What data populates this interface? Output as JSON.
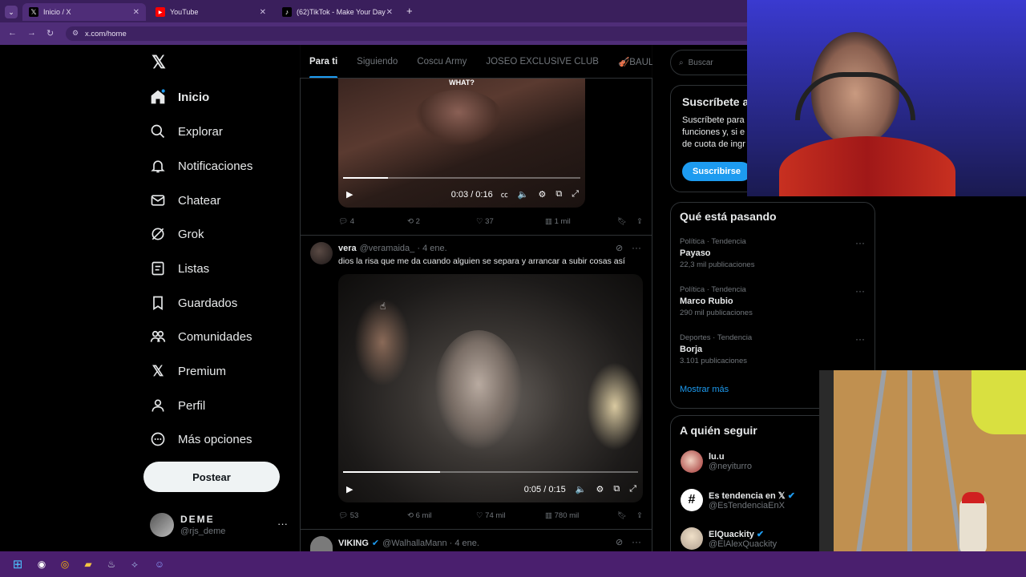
{
  "browser": {
    "tabs": [
      {
        "label": "Inicio / X",
        "icon": "x-logo-icon",
        "active": true
      },
      {
        "label": "YouTube",
        "icon": "youtube-icon",
        "active": false
      },
      {
        "label": "(62)TikTok - Make Your Day",
        "icon": "tiktok-icon",
        "active": false
      }
    ],
    "url": "x.com/home"
  },
  "sidebar": {
    "items": [
      {
        "label": "Inicio",
        "icon": "home-icon"
      },
      {
        "label": "Explorar",
        "icon": "search-icon"
      },
      {
        "label": "Notificaciones",
        "icon": "bell-icon"
      },
      {
        "label": "Chatear",
        "icon": "mail-icon"
      },
      {
        "label": "Grok",
        "icon": "grok-icon"
      },
      {
        "label": "Listas",
        "icon": "list-icon"
      },
      {
        "label": "Guardados",
        "icon": "bookmark-icon"
      },
      {
        "label": "Comunidades",
        "icon": "people-icon"
      },
      {
        "label": "Premium",
        "icon": "x-logo-icon"
      },
      {
        "label": "Perfil",
        "icon": "person-icon"
      },
      {
        "label": "Más opciones",
        "icon": "more-circle-icon"
      }
    ],
    "post_label": "Postear",
    "account": {
      "name": "DEME",
      "handle": "@rjs_deme"
    }
  },
  "feed": {
    "tabs": [
      "Para ti",
      "Siguiendo",
      "Coscu Army",
      "JOSEO EXCLUSIVE CLUB",
      "🎻BAULO C"
    ],
    "tweet1": {
      "video_caption": "WHAT?",
      "time": "0:03 / 0:16",
      "progress": 0.19,
      "replies": "4",
      "reposts": "2",
      "likes": "37",
      "views": "1 mil"
    },
    "tweet2": {
      "name": "vera",
      "handle": "@veramaida_",
      "date": "· 4 ene.",
      "text": "dios la risa que me da cuando alguien se separa y arrancar a subir cosas así",
      "time": "0:05 / 0:15",
      "progress": 0.33,
      "replies": "53",
      "reposts": "6 mil",
      "likes": "74 mil",
      "views": "780 mil"
    },
    "tweet3": {
      "name": "VIKING",
      "handle": "@WalhallaMann",
      "date": "· 4 ene."
    }
  },
  "right": {
    "search_placeholder": "Buscar",
    "premium": {
      "title": "Suscríbete a",
      "body_lines": [
        "Suscríbete para",
        "funciones y, si e",
        "de cuota de ingr"
      ],
      "button": "Suscribirse"
    },
    "trends_title": "Qué está pasando",
    "trends": [
      {
        "category": "Política · Tendencia",
        "name": "Payaso",
        "count": "22,3 mil publicaciones"
      },
      {
        "category": "Política · Tendencia",
        "name": "Marco Rubio",
        "count": "290 mil publicaciones"
      },
      {
        "category": "Deportes · Tendencia",
        "name": "Borja",
        "count": "3.101 publicaciones"
      }
    ],
    "show_more": "Mostrar más",
    "follow_title": "A quién seguir",
    "follow": [
      {
        "name": "lu.u",
        "handle": "@neyiturro"
      },
      {
        "name": "Es tendencia en 𝕏",
        "handle": "@EsTendenciaEnX"
      },
      {
        "name": "ElQuackity",
        "handle": "@ElAlexQuackity"
      }
    ]
  },
  "colors": {
    "accent": "#1d9bf0",
    "browser": "#4f2d78",
    "taskbar": "#4a1f6e"
  }
}
